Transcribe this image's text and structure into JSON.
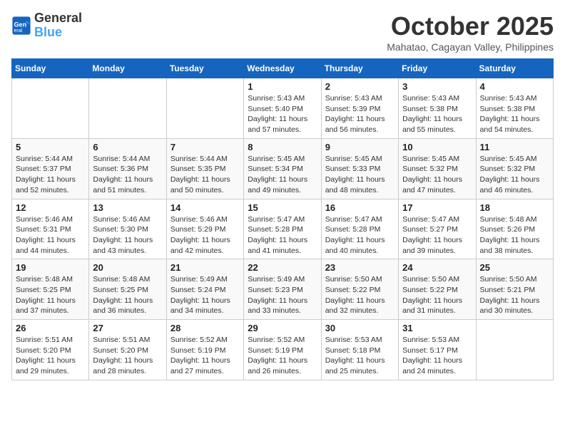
{
  "logo": {
    "line1": "General",
    "line2": "Blue"
  },
  "title": "October 2025",
  "subtitle": "Mahatao, Cagayan Valley, Philippines",
  "days_header": [
    "Sunday",
    "Monday",
    "Tuesday",
    "Wednesday",
    "Thursday",
    "Friday",
    "Saturday"
  ],
  "weeks": [
    [
      {
        "day": "",
        "info": ""
      },
      {
        "day": "",
        "info": ""
      },
      {
        "day": "",
        "info": ""
      },
      {
        "day": "1",
        "info": "Sunrise: 5:43 AM\nSunset: 5:40 PM\nDaylight: 11 hours and 57 minutes."
      },
      {
        "day": "2",
        "info": "Sunrise: 5:43 AM\nSunset: 5:39 PM\nDaylight: 11 hours and 56 minutes."
      },
      {
        "day": "3",
        "info": "Sunrise: 5:43 AM\nSunset: 5:38 PM\nDaylight: 11 hours and 55 minutes."
      },
      {
        "day": "4",
        "info": "Sunrise: 5:43 AM\nSunset: 5:38 PM\nDaylight: 11 hours and 54 minutes."
      }
    ],
    [
      {
        "day": "5",
        "info": "Sunrise: 5:44 AM\nSunset: 5:37 PM\nDaylight: 11 hours and 52 minutes."
      },
      {
        "day": "6",
        "info": "Sunrise: 5:44 AM\nSunset: 5:36 PM\nDaylight: 11 hours and 51 minutes."
      },
      {
        "day": "7",
        "info": "Sunrise: 5:44 AM\nSunset: 5:35 PM\nDaylight: 11 hours and 50 minutes."
      },
      {
        "day": "8",
        "info": "Sunrise: 5:45 AM\nSunset: 5:34 PM\nDaylight: 11 hours and 49 minutes."
      },
      {
        "day": "9",
        "info": "Sunrise: 5:45 AM\nSunset: 5:33 PM\nDaylight: 11 hours and 48 minutes."
      },
      {
        "day": "10",
        "info": "Sunrise: 5:45 AM\nSunset: 5:32 PM\nDaylight: 11 hours and 47 minutes."
      },
      {
        "day": "11",
        "info": "Sunrise: 5:45 AM\nSunset: 5:32 PM\nDaylight: 11 hours and 46 minutes."
      }
    ],
    [
      {
        "day": "12",
        "info": "Sunrise: 5:46 AM\nSunset: 5:31 PM\nDaylight: 11 hours and 44 minutes."
      },
      {
        "day": "13",
        "info": "Sunrise: 5:46 AM\nSunset: 5:30 PM\nDaylight: 11 hours and 43 minutes."
      },
      {
        "day": "14",
        "info": "Sunrise: 5:46 AM\nSunset: 5:29 PM\nDaylight: 11 hours and 42 minutes."
      },
      {
        "day": "15",
        "info": "Sunrise: 5:47 AM\nSunset: 5:28 PM\nDaylight: 11 hours and 41 minutes."
      },
      {
        "day": "16",
        "info": "Sunrise: 5:47 AM\nSunset: 5:28 PM\nDaylight: 11 hours and 40 minutes."
      },
      {
        "day": "17",
        "info": "Sunrise: 5:47 AM\nSunset: 5:27 PM\nDaylight: 11 hours and 39 minutes."
      },
      {
        "day": "18",
        "info": "Sunrise: 5:48 AM\nSunset: 5:26 PM\nDaylight: 11 hours and 38 minutes."
      }
    ],
    [
      {
        "day": "19",
        "info": "Sunrise: 5:48 AM\nSunset: 5:25 PM\nDaylight: 11 hours and 37 minutes."
      },
      {
        "day": "20",
        "info": "Sunrise: 5:48 AM\nSunset: 5:25 PM\nDaylight: 11 hours and 36 minutes."
      },
      {
        "day": "21",
        "info": "Sunrise: 5:49 AM\nSunset: 5:24 PM\nDaylight: 11 hours and 34 minutes."
      },
      {
        "day": "22",
        "info": "Sunrise: 5:49 AM\nSunset: 5:23 PM\nDaylight: 11 hours and 33 minutes."
      },
      {
        "day": "23",
        "info": "Sunrise: 5:50 AM\nSunset: 5:22 PM\nDaylight: 11 hours and 32 minutes."
      },
      {
        "day": "24",
        "info": "Sunrise: 5:50 AM\nSunset: 5:22 PM\nDaylight: 11 hours and 31 minutes."
      },
      {
        "day": "25",
        "info": "Sunrise: 5:50 AM\nSunset: 5:21 PM\nDaylight: 11 hours and 30 minutes."
      }
    ],
    [
      {
        "day": "26",
        "info": "Sunrise: 5:51 AM\nSunset: 5:20 PM\nDaylight: 11 hours and 29 minutes."
      },
      {
        "day": "27",
        "info": "Sunrise: 5:51 AM\nSunset: 5:20 PM\nDaylight: 11 hours and 28 minutes."
      },
      {
        "day": "28",
        "info": "Sunrise: 5:52 AM\nSunset: 5:19 PM\nDaylight: 11 hours and 27 minutes."
      },
      {
        "day": "29",
        "info": "Sunrise: 5:52 AM\nSunset: 5:19 PM\nDaylight: 11 hours and 26 minutes."
      },
      {
        "day": "30",
        "info": "Sunrise: 5:53 AM\nSunset: 5:18 PM\nDaylight: 11 hours and 25 minutes."
      },
      {
        "day": "31",
        "info": "Sunrise: 5:53 AM\nSunset: 5:17 PM\nDaylight: 11 hours and 24 minutes."
      },
      {
        "day": "",
        "info": ""
      }
    ]
  ]
}
